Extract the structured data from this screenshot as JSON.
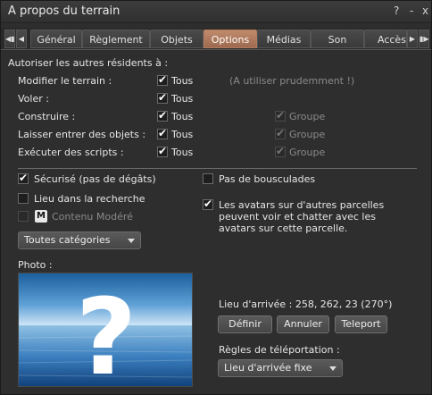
{
  "window": {
    "title": "A propos du terrain",
    "help_glyph": "?",
    "minimize_glyph": "-",
    "close_glyph": "x"
  },
  "tabs": [
    {
      "label": "Général"
    },
    {
      "label": "Règlement"
    },
    {
      "label": "Objets"
    },
    {
      "label": "Options",
      "active": true
    },
    {
      "label": "Médias"
    },
    {
      "label": "Son"
    },
    {
      "label": "Accès"
    }
  ],
  "options": {
    "header": "Autoriser les autres résidents à :",
    "rows": [
      {
        "label": "Modifier le terrain :",
        "tous": "Tous",
        "tous_checked": true,
        "note": "(A utiliser prudemment !)"
      },
      {
        "label": "Voler :",
        "tous": "Tous",
        "tous_checked": true
      },
      {
        "label": "Construire :",
        "tous": "Tous",
        "tous_checked": true,
        "groupe": "Groupe",
        "groupe_checked": true
      },
      {
        "label": "Laisser entrer des objets :",
        "tous": "Tous",
        "tous_checked": true,
        "groupe": "Groupe",
        "groupe_checked": true
      },
      {
        "label": "Exécuter des scripts :",
        "tous": "Tous",
        "tous_checked": true,
        "groupe": "Groupe",
        "groupe_checked": true
      }
    ],
    "securise": {
      "label": "Sécurisé (pas de dégâts)",
      "checked": true
    },
    "pas_bousculades": {
      "label": "Pas de bousculades",
      "checked": false
    },
    "lieu_recherche": {
      "label": "Lieu dans la recherche",
      "checked": false
    },
    "contenu_modere": {
      "label": "Contenu Modéré",
      "checked": false,
      "badge": "M"
    },
    "avatars": {
      "label_lines": [
        "Les avatars sur d'autres parcelles",
        "peuvent voir et chatter avec les",
        "avatars sur cette parcelle."
      ],
      "checked": true
    },
    "categorie_dropdown": "Toutes catégories",
    "photo_label": "Photo :",
    "photo_placeholder": "?",
    "lieu_arrivee": "Lieu d'arrivée : 258, 262, 23 (270°)",
    "buttons": {
      "definir": "Définir",
      "annuler": "Annuler",
      "teleport": "Teleport"
    },
    "regles_label": "Règles de téléportation :",
    "regles_dropdown": "Lieu d'arrivée fixe"
  }
}
